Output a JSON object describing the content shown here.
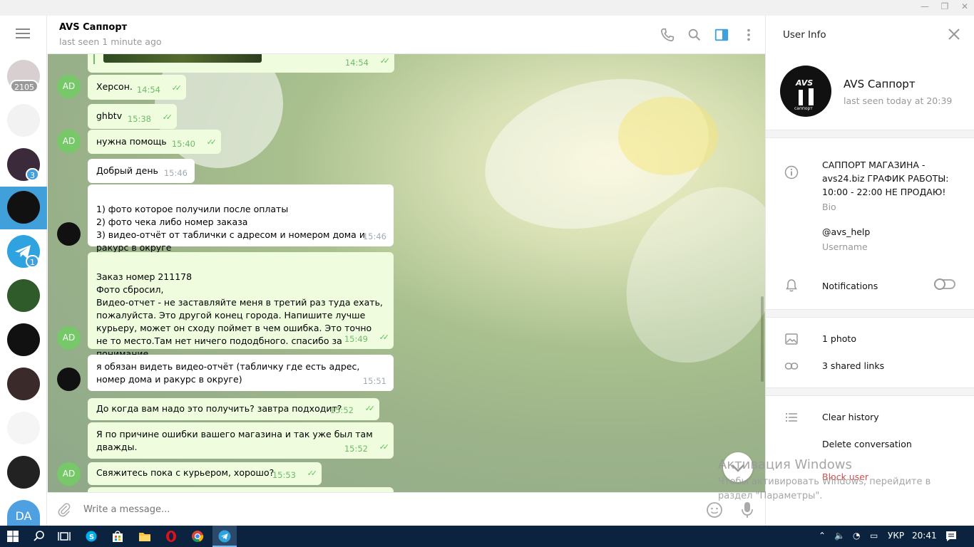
{
  "window": {
    "minimize": "—",
    "restore": "❐",
    "close": "✕"
  },
  "sidebar": {
    "chats": [
      {
        "name": "chat-1",
        "badge": "2105",
        "badge_muted": true,
        "color": "#d8d0d0"
      },
      {
        "name": "chat-2",
        "badge": "",
        "color": "#f2f2f2"
      },
      {
        "name": "chat-3",
        "badge": "3",
        "color": "#3a2a3a"
      },
      {
        "name": "chat-avs",
        "badge": "",
        "color": "#111111",
        "active": true
      },
      {
        "name": "chat-telegram",
        "badge": "1",
        "color": "#2fa3e0"
      },
      {
        "name": "chat-6",
        "badge": "",
        "color": "#2f5a2a"
      },
      {
        "name": "chat-7",
        "badge": "",
        "color": "#111111"
      },
      {
        "name": "chat-8",
        "badge": "",
        "color": "#3a2a2a"
      },
      {
        "name": "chat-9",
        "badge": "",
        "color": "#f5f5f5"
      },
      {
        "name": "chat-10",
        "badge": "",
        "color": "#222222"
      }
    ],
    "self_initials": "DA",
    "self_color": "#4fa0e0"
  },
  "header": {
    "title": "AVS Саппорт",
    "status": "last seen 1 minute ago"
  },
  "messages": [
    {
      "text": "",
      "time": "14:54",
      "out": true
    },
    {
      "text": "Херсон.",
      "time": "14:54",
      "out": true
    },
    {
      "text": "ghbtv",
      "time": "15:38",
      "out": true
    },
    {
      "text": "нужна помощь",
      "time": "15:40",
      "out": true
    },
    {
      "text": "Добрый день",
      "time": "15:46",
      "out": false
    },
    {
      "text": "1) фото которое получили после оплаты\n2) фото чека либо номер заказа\n3) видео-отчёт от таблички с адресом и номером дома и ракурс в округе",
      "time": "15:46",
      "out": false
    },
    {
      "text": "Заказ номер 211178\nФото сбросил,\nВидео-отчет - не заставляйте меня в третий раз туда ехать, пожалуйста. Это другой конец города. Напишите лучше курьеру, может он сходу поймет в чем ошибка. Это точно не то место.Там нет ничего пододбного. спасибо за понимание",
      "time": "15:49",
      "out": true
    },
    {
      "text": "я обязан видеть видео-отчёт (табличку где есть адрес, номер дома и ракурс в округе)",
      "time": "15:51",
      "out": false
    },
    {
      "text": "До когда вам надо это получить? завтра подходит?",
      "time": "15:52",
      "out": true
    },
    {
      "text": "Я по причине ошибки вашего магазина и так уже был там дважды.",
      "time": "15:52",
      "out": true
    },
    {
      "text": "Свяжитесь пока с курьером, хорошо?",
      "time": "15:53",
      "out": true
    }
  ],
  "avatars": {
    "me": "AD"
  },
  "composer": {
    "placeholder": "Write a message..."
  },
  "info": {
    "title": "User Info",
    "name": "AVS Саппорт",
    "seen": "last seen today at 20:39",
    "bio": "САППОРТ МАГАЗИНА - avs24.biz ГРАФИК РАБОТЫ: 10:00 - 22:00 НЕ ПРОДАЮ!",
    "bio_label": "Bio",
    "username": "@avs_help",
    "username_label": "Username",
    "notifications": "Notifications",
    "notifications_on": false,
    "photos": "1 photo",
    "links": "3 shared links",
    "clear_history": "Clear history",
    "delete_conversation": "Delete conversation",
    "block_user": "Block user"
  },
  "watermark": {
    "line1": "Активация Windows",
    "line2": "Чтобы активировать Windows, перейдите в раздел \"Параметры\"."
  },
  "taskbar": {
    "lang": "УКР",
    "clock": "20:41"
  }
}
